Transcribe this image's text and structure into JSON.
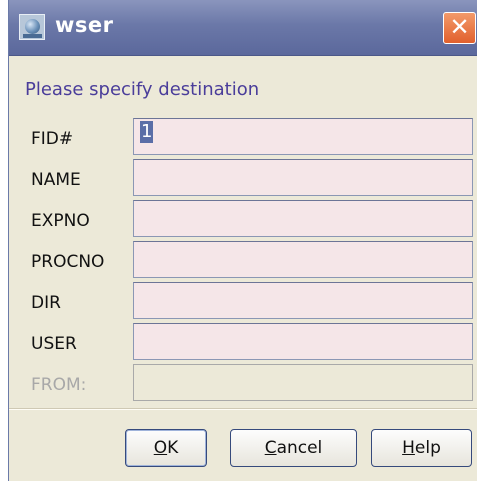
{
  "window": {
    "title": "wser",
    "close_glyph": "✕",
    "app_icon": "topspin-drop-icon",
    "title_bar_color": "#6b78a8",
    "close_button_color": "#e1602d"
  },
  "form": {
    "subtitle": "Please specify destination",
    "fields": [
      {
        "label": "FID#",
        "value": "1",
        "enabled": true
      },
      {
        "label": "NAME",
        "value": "",
        "enabled": true
      },
      {
        "label": "EXPNO",
        "value": "",
        "enabled": true
      },
      {
        "label": "PROCNO",
        "value": "",
        "enabled": true
      },
      {
        "label": "DIR",
        "value": "",
        "enabled": true
      },
      {
        "label": "USER",
        "value": "",
        "enabled": true
      },
      {
        "label": "FROM:",
        "value": "",
        "enabled": false
      }
    ]
  },
  "buttons": {
    "ok": {
      "mnemonic": "O",
      "rest": "K"
    },
    "cancel": {
      "mnemonic": "C",
      "rest": "ancel"
    },
    "help": {
      "mnemonic": "H",
      "rest": "elp"
    }
  }
}
